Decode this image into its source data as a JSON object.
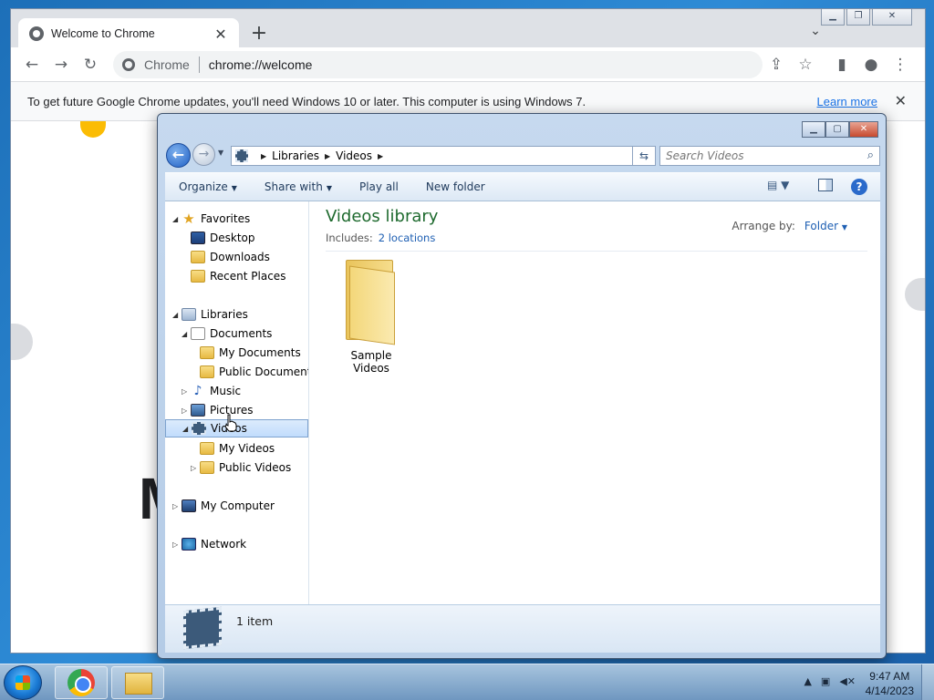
{
  "chrome": {
    "tab_title": "Welcome to Chrome",
    "new_tab_icon": "plus-icon",
    "omnibox_label": "Chrome",
    "url": "chrome://welcome",
    "infobar_text": "To get future Google Chrome updates, you'll need Windows 10 or later. This computer is using Windows 7.",
    "infobar_link": "Learn more",
    "page_letter": "M"
  },
  "explorer": {
    "breadcrumb": [
      "Libraries",
      "Videos"
    ],
    "search_placeholder": "Search Videos",
    "commands": {
      "organize": "Organize",
      "share_with": "Share with",
      "play_all": "Play all",
      "new_folder": "New folder"
    },
    "nav": {
      "favorites": "Favorites",
      "desktop": "Desktop",
      "downloads": "Downloads",
      "recent_places": "Recent Places",
      "libraries": "Libraries",
      "documents": "Documents",
      "my_documents": "My Documents",
      "public_documents": "Public Documents",
      "music": "Music",
      "pictures": "Pictures",
      "videos": "Videos",
      "my_videos": "My Videos",
      "public_videos": "Public Videos",
      "my_computer": "My Computer",
      "network": "Network"
    },
    "library_title": "Videos library",
    "includes_label": "Includes:",
    "includes_link": "2 locations",
    "arrange_label": "Arrange by:",
    "arrange_value": "Folder",
    "items": [
      {
        "name": "Sample Videos"
      }
    ],
    "status": "1 item"
  },
  "taskbar": {
    "time": "9:47 AM",
    "date": "4/14/2023"
  },
  "colors": {
    "library_title": "#1e6a2e",
    "link": "#1e5fb3",
    "chrome_link": "#1a73e8"
  }
}
